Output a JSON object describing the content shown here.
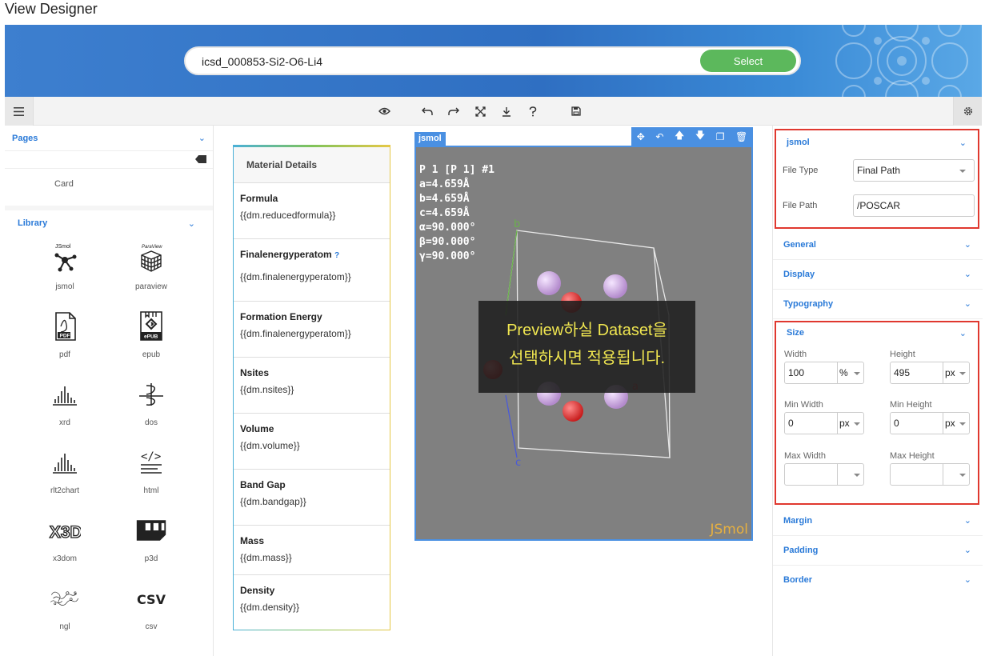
{
  "app": {
    "title": "View Designer"
  },
  "search": {
    "value": "icsd_000853-Si2-O6-Li4",
    "button": "Select"
  },
  "toolbar": {
    "icons": [
      "menu-icon",
      "eye-icon",
      "undo-icon",
      "redo-icon",
      "fullscreen-icon",
      "download-icon",
      "help-icon",
      "save-icon",
      "gear-icon"
    ]
  },
  "left": {
    "pages_label": "Pages",
    "pages_item": "Card",
    "library_label": "Library",
    "library": [
      {
        "label": "jsmol",
        "icon": "jsmol-icon"
      },
      {
        "label": "paraview",
        "icon": "paraview-icon"
      },
      {
        "label": "pdf",
        "icon": "pdf-icon"
      },
      {
        "label": "epub",
        "icon": "epub-icon"
      },
      {
        "label": "xrd",
        "icon": "xrd-icon"
      },
      {
        "label": "dos",
        "icon": "dos-icon"
      },
      {
        "label": "rlt2chart",
        "icon": "rlt2chart-icon"
      },
      {
        "label": "html",
        "icon": "html-icon"
      },
      {
        "label": "x3dom",
        "icon": "x3dom-icon"
      },
      {
        "label": "p3d",
        "icon": "p3d-icon"
      },
      {
        "label": "ngl",
        "icon": "ngl-icon"
      },
      {
        "label": "csv",
        "icon": "csv-icon"
      }
    ],
    "icon_texts": {
      "jsmol": "JSmol",
      "paraview": "ParaView",
      "pdf": "PDF",
      "epub": "ePUB",
      "x3d": "X3D",
      "csv": "CSV",
      "html": "</>"
    }
  },
  "card": {
    "title": "Material Details",
    "fields": [
      {
        "name": "Formula",
        "value": "{{dm.reducedformula}}"
      },
      {
        "name": "Finalenergyperatom",
        "value": "{{dm.finalenergyperatom}}",
        "help": "?"
      },
      {
        "name": "Formation Energy",
        "value": "{{dm.finalenergyperatom}}"
      },
      {
        "name": "Nsites",
        "value": "{{dm.nsites}}"
      },
      {
        "name": "Volume",
        "value": "{{dm.volume}}"
      },
      {
        "name": "Band Gap",
        "value": "{{dm.bandgap}}"
      },
      {
        "name": "Mass",
        "value": "{{dm.mass}}"
      },
      {
        "name": "Density",
        "value": "{{dm.density}}"
      }
    ]
  },
  "jsmol": {
    "tag": "jsmol",
    "cell_info": "P 1 [P 1] #1\na=4.659Å\nb=4.659Å\nc=4.659Å\nα=90.000°\nβ=90.000°\nγ=90.000°",
    "axis_b": "b",
    "axis_c": "c",
    "axis_a": "a",
    "preview_line1": "Preview하실 Dataset을",
    "preview_line2": "선택하시면 적용됩니다.",
    "brand": "JSmol"
  },
  "props": {
    "jsmol_label": "jsmol",
    "file_type_label": "File Type",
    "file_type_value": "Final Path",
    "file_path_label": "File Path",
    "file_path_value": "/POSCAR",
    "general": "General",
    "display": "Display",
    "typography": "Typography",
    "size": "Size",
    "width_label": "Width",
    "width_value": "100",
    "width_unit": "%",
    "height_label": "Height",
    "height_value": "495",
    "height_unit": "px",
    "min_width_label": "Min Width",
    "min_width_value": "0",
    "min_width_unit": "px",
    "min_height_label": "Min Height",
    "min_height_value": "0",
    "min_height_unit": "px",
    "max_width_label": "Max Width",
    "max_height_label": "Max Height",
    "margin": "Margin",
    "padding": "Padding",
    "border": "Border"
  },
  "colors": {
    "accent": "#2a7ad8",
    "highlight": "#e0382f",
    "select": "#5cb85c",
    "jsmol_bg": "#808080"
  }
}
